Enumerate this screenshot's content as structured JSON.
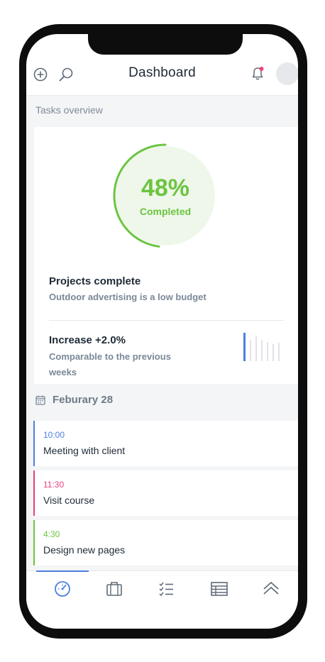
{
  "header": {
    "title": "Dashboard",
    "icons": [
      "add-circle-icon",
      "search-icon",
      "bell-icon",
      "avatar"
    ],
    "notification_dot_color": "#f2417a"
  },
  "overview": {
    "section_label": "Tasks overview",
    "progress": {
      "percent_label": "48%",
      "caption": "Completed",
      "fraction": 0.48,
      "color": "#6cc440"
    },
    "projects": {
      "title": "Projects complete",
      "subtitle": "Outdoor advertising is a low budget"
    },
    "increase": {
      "title": "Increase +2.0%",
      "subtitle_line1": "Comparable to the previous",
      "subtitle_line2": "weeks"
    }
  },
  "schedule": {
    "date_label": "Feburary 28",
    "events": [
      {
        "time": "10:00",
        "name": "Meeting with client",
        "color": "#4c7fe0"
      },
      {
        "time": "11:30",
        "name": "Visit course",
        "color": "#e8417f"
      },
      {
        "time": "4:30",
        "name": "Design new pages",
        "color": "#6cc440"
      }
    ]
  },
  "bottom_nav": {
    "items": [
      "dashboard-icon",
      "briefcase-icon",
      "checklist-icon",
      "table-icon",
      "chevron-up-icon"
    ],
    "active_index": 0,
    "active_color": "#4c7fe0"
  }
}
